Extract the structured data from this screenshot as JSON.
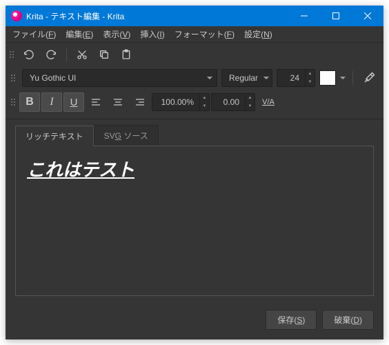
{
  "window": {
    "title": "Krita - テキスト編集 - Krita"
  },
  "menu": {
    "file": "ファイル(F)",
    "edit": "編集(E)",
    "view": "表示(V)",
    "insert": "挿入(I)",
    "format": "フォーマット(F)",
    "settings": "設定(N)"
  },
  "font": {
    "family": "Yu Gothic UI",
    "style": "Regular",
    "size": "24",
    "color": "#ffffff"
  },
  "format": {
    "ratio": "100.00%",
    "spacing": "0.00",
    "kerning_label": "V/A"
  },
  "tabs": {
    "rich_text": "リッチテキスト",
    "svg_source": "SVG ソース"
  },
  "canvas": {
    "text": "これはテスト"
  },
  "buttons": {
    "save": "保存(S)",
    "discard": "破棄(D)"
  }
}
